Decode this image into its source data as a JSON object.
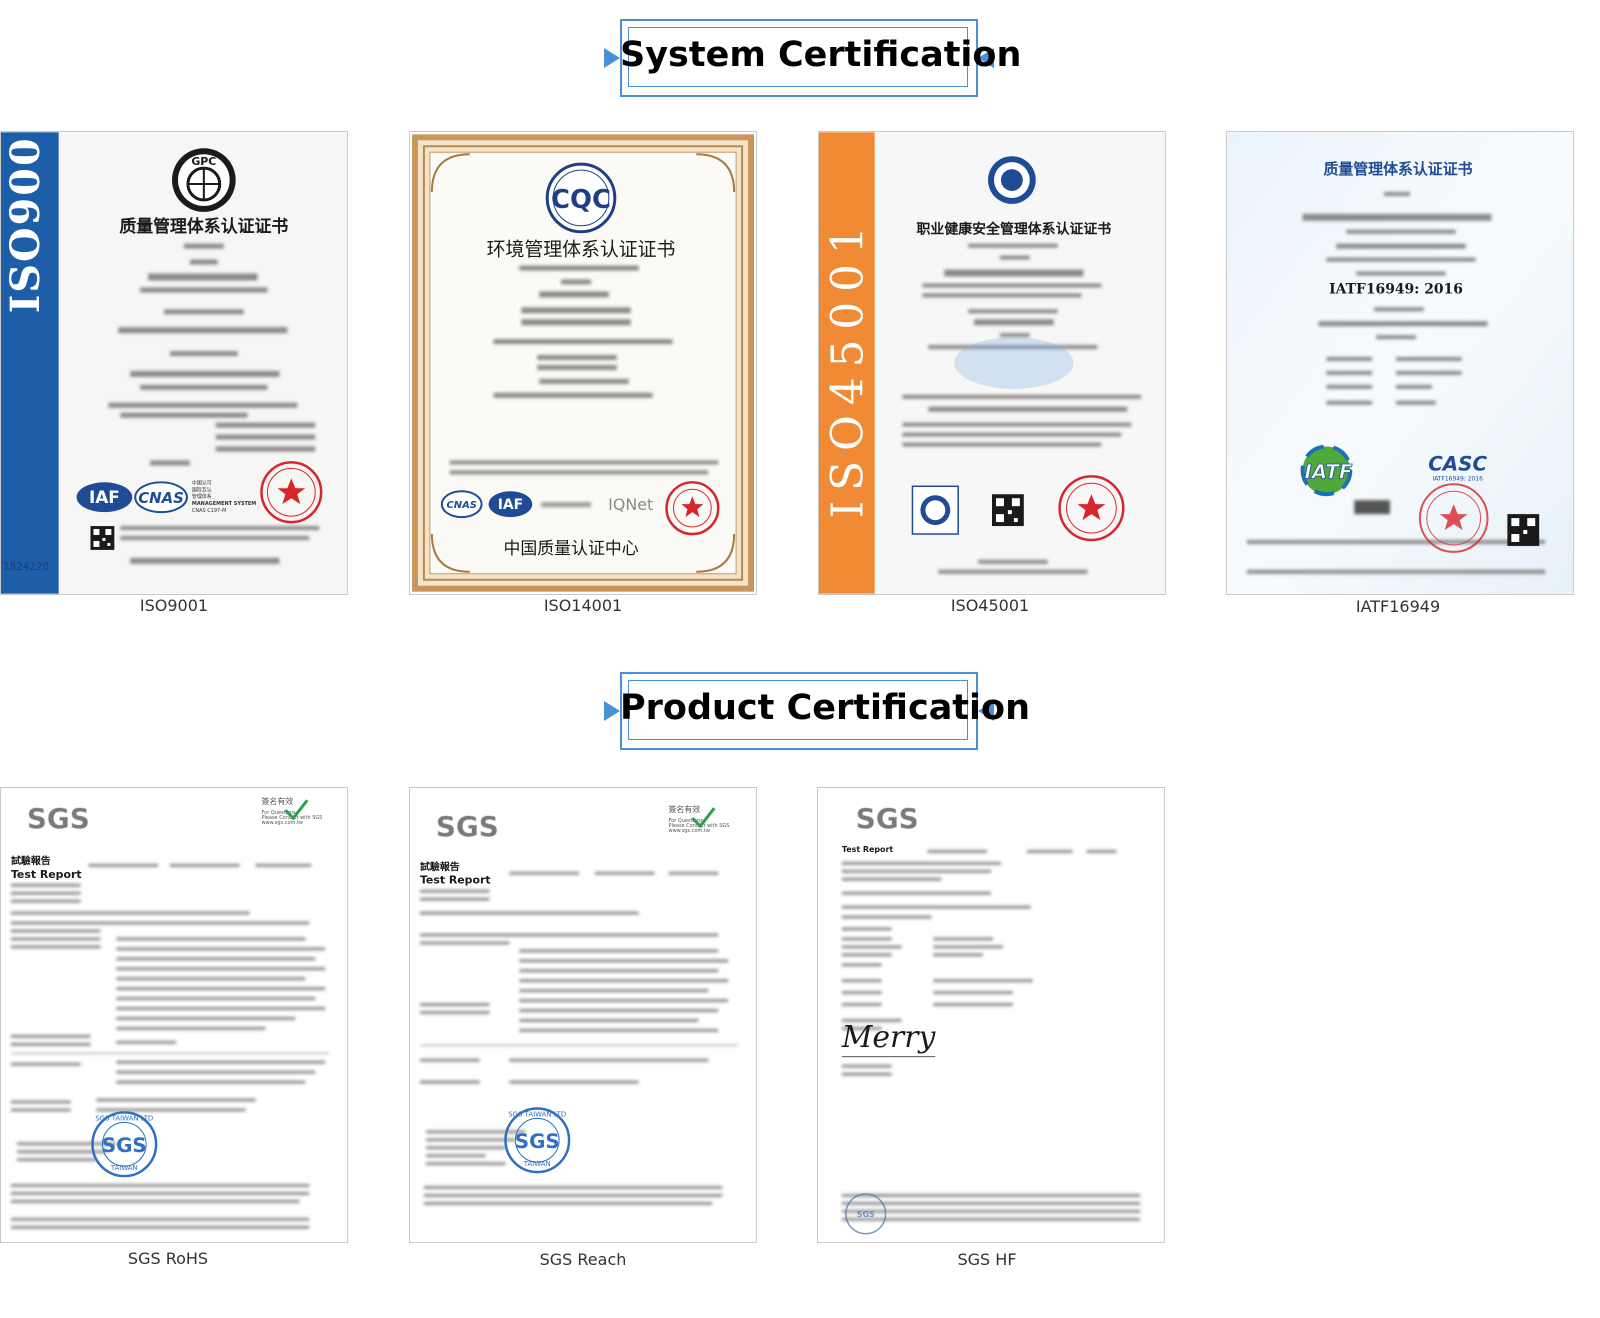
{
  "system_section": {
    "title": "System Certification",
    "certificates": [
      {
        "caption": "ISO9001",
        "side_band_text": "ISO9001",
        "logo_text": "GPC",
        "heading": "质量管理体系认证证书",
        "serial_text": "1824220",
        "badge_left": "IAF",
        "badge_right": "CNAS",
        "badge_note_1": "中国认可",
        "badge_note_2": "国际互认",
        "badge_note_3": "管理体系",
        "badge_note_4": "MANAGEMENT SYSTEM",
        "badge_note_5": "CNAS C197-M"
      },
      {
        "caption": "ISO14001",
        "logo_text": "CQC",
        "heading": "环境管理体系认证证书",
        "badge_left": "CNAS",
        "badge_mid": "IAF",
        "badge_right": "IQNet",
        "footer": "中国质量认证中心"
      },
      {
        "caption": "ISO45001",
        "side_band_text": "ISO45001",
        "heading": "职业健康安全管理体系认证证书"
      },
      {
        "caption": "IATF16949",
        "heading": "质量管理体系认证证书",
        "standard": "IATF16949: 2016",
        "badge_left": "IATF",
        "badge_right": "CASC",
        "badge_right_sub": "IATF16949: 2016"
      }
    ]
  },
  "product_section": {
    "title": "Product Certification",
    "reports": [
      {
        "caption": "SGS RoHS",
        "brand": "SGS",
        "label_cn": "試驗報告",
        "label_en": "Test Report",
        "stamp": "SGS",
        "stamp_ring": "SGS TAIWAN LTD",
        "stamp_ring_bottom": "TAIWAN",
        "corner_cn": "簽名有效",
        "corner_1": "For Questions",
        "corner_2": "Please Contact with SGS",
        "corner_3": "www.sgs.com.tw"
      },
      {
        "caption": "SGS Reach",
        "brand": "SGS",
        "label_cn": "試驗報告",
        "label_en": "Test Report",
        "stamp": "SGS",
        "stamp_ring": "SGS TAIWAN LTD",
        "stamp_ring_bottom": "TAIWAN",
        "corner_cn": "簽名有效",
        "corner_1": "For Questions",
        "corner_2": "Please Contact with SGS",
        "corner_3": "www.sgs.com.tw"
      },
      {
        "caption": "SGS HF",
        "brand": "SGS",
        "label_en": "Test Report",
        "signature": "Merry",
        "stamp": "SGS"
      }
    ]
  },
  "colors": {
    "accent_blue": "#4a90d9",
    "iso9001_band": "#1c5ea8",
    "iso45001_band": "#f08a34",
    "seal_red": "#d7262b",
    "frame_gold": "#b88a52"
  }
}
